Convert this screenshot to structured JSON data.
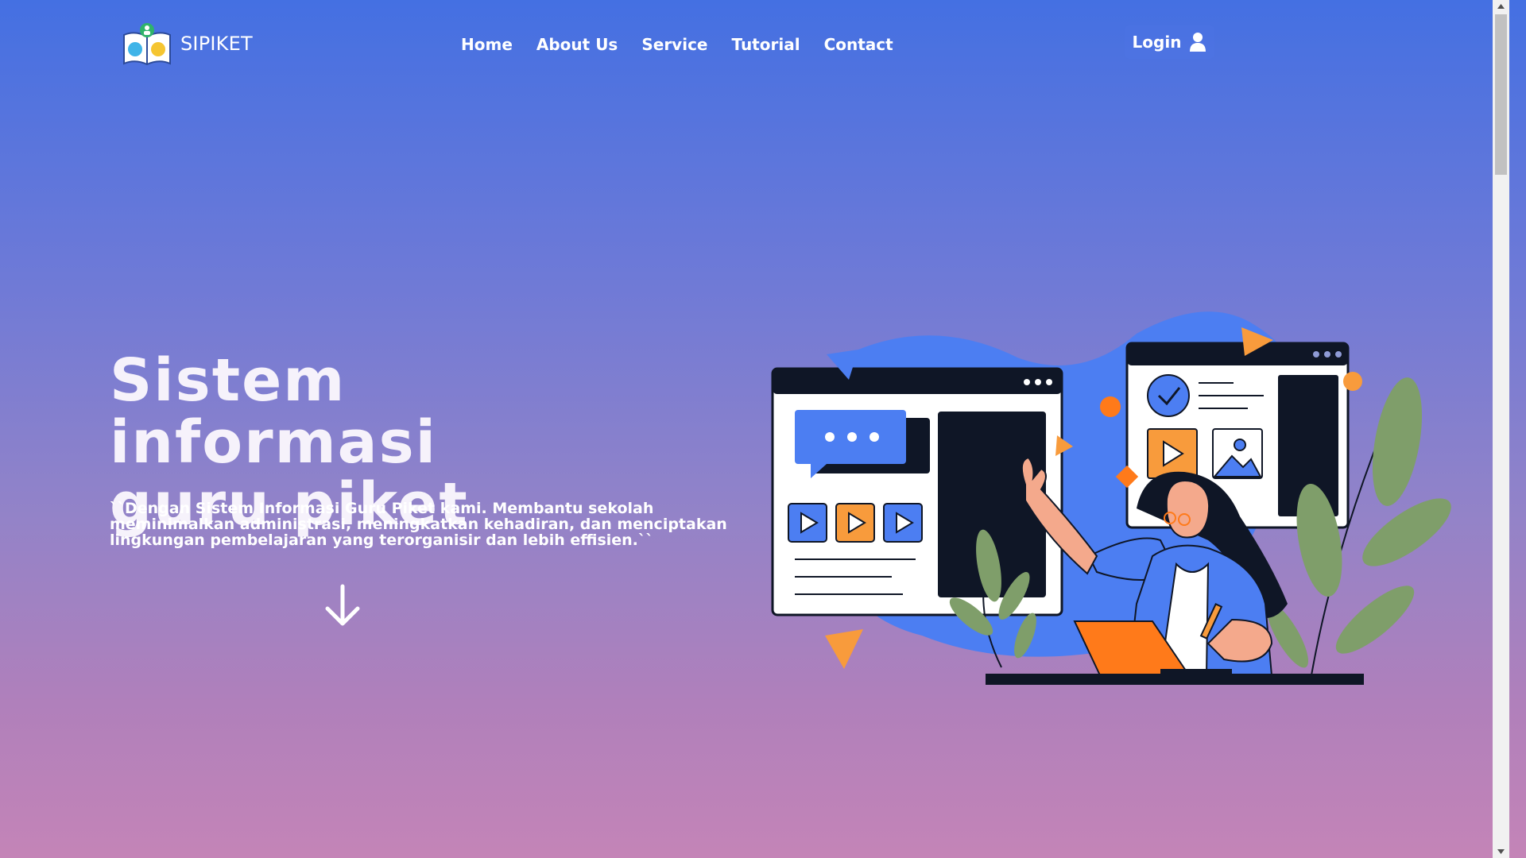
{
  "header": {
    "brand": "SIPIKET",
    "nav": [
      "Home",
      "About Us",
      "Service",
      "Tutorial",
      "Contact"
    ],
    "login_label": "Login"
  },
  "hero": {
    "title_line1": "Sistem informasi",
    "title_line2": "guru piket",
    "description": "``Dengan Sistem Informasi Guru Piket kami. Membantu sekolah meminimalkan administrasi, meningkatkan kehadiran, dan menciptakan lingkungan pembelajaran yang terorganisir dan lebih effisien.``"
  },
  "icons": {
    "logo": "book-school-logo-icon",
    "login": "user-icon",
    "scroll_down": "arrow-down-icon"
  },
  "colors": {
    "gradient_top": "#4470e2",
    "gradient_bottom": "#c484b7",
    "illustration_blue": "#4c7ef2",
    "illustration_orange": "#ff7a1a",
    "illustration_dark": "#0f1626",
    "illustration_green": "#7f9e6a"
  }
}
